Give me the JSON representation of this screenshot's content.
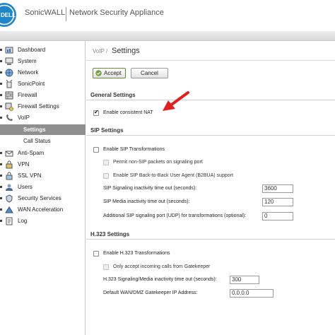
{
  "header": {
    "logo_text": "DELL",
    "brand": "SonicWALL",
    "product": "Network Security Appliance"
  },
  "sidebar": {
    "items": [
      {
        "label": "Dashboard",
        "icon": "dashboard-icon"
      },
      {
        "label": "System",
        "icon": "system-icon"
      },
      {
        "label": "Network",
        "icon": "network-icon"
      },
      {
        "label": "SonicPoint",
        "icon": "sonicpoint-icon"
      },
      {
        "label": "Firewall",
        "icon": "firewall-icon"
      },
      {
        "label": "Firewall Settings",
        "icon": "firewall-settings-icon"
      },
      {
        "label": "VoIP",
        "icon": "voip-icon"
      },
      {
        "label": "Anti-Spam",
        "icon": "anti-spam-icon"
      },
      {
        "label": "VPN",
        "icon": "vpn-icon"
      },
      {
        "label": "SSL VPN",
        "icon": "ssl-vpn-icon"
      },
      {
        "label": "Users",
        "icon": "users-icon"
      },
      {
        "label": "Security Services",
        "icon": "security-services-icon"
      },
      {
        "label": "WAN Acceleration",
        "icon": "wan-acceleration-icon"
      },
      {
        "label": "Log",
        "icon": "log-icon"
      }
    ],
    "voip_children": [
      {
        "label": "Settings",
        "active": true
      },
      {
        "label": "Call Status",
        "active": false
      }
    ]
  },
  "breadcrumb": {
    "parent": "VoIP /",
    "title": "Settings"
  },
  "buttons": {
    "accept": "Accept",
    "cancel": "Cancel"
  },
  "general": {
    "heading": "General Settings",
    "consistent_nat": {
      "label": "Enable consistent NAT",
      "checked": true
    }
  },
  "sip": {
    "heading": "SIP Settings",
    "enable": {
      "label": "Enable SIP Transformations",
      "checked": false
    },
    "permit_non_sip": {
      "label": "Permit non-SIP packets on signaling port",
      "checked": false
    },
    "b2bua": {
      "label": "Enable SIP Back-to-Back User Agent (B2BUA) support",
      "checked": false
    },
    "signaling_timeout": {
      "label": "SIP Signaling inactivity time out (seconds):",
      "value": "3600"
    },
    "media_timeout": {
      "label": "SIP Media inactivity time out (seconds):",
      "value": "120"
    },
    "udp_port": {
      "label": "Additional SIP signaling port (UDP) for transformations (optional):",
      "value": "0"
    }
  },
  "h323": {
    "heading": "H.323 Settings",
    "enable": {
      "label": "Enable H.323 Transformations",
      "checked": false
    },
    "only_gatekeeper": {
      "label": "Only accept incoming calls from Gatekeeper",
      "checked": false
    },
    "timeout": {
      "label": "H.323 Signaling/Media inactivity time out (seconds):",
      "value": "300"
    },
    "gatekeeper_ip": {
      "label": "Default WAN/DMZ Gatekeeper IP Address:",
      "value": "0.0.0.0"
    }
  },
  "colors": {
    "accent_arrow": "#e02020",
    "active_nav": "#8f8f8f",
    "accept_border": "#6a8a3a"
  }
}
